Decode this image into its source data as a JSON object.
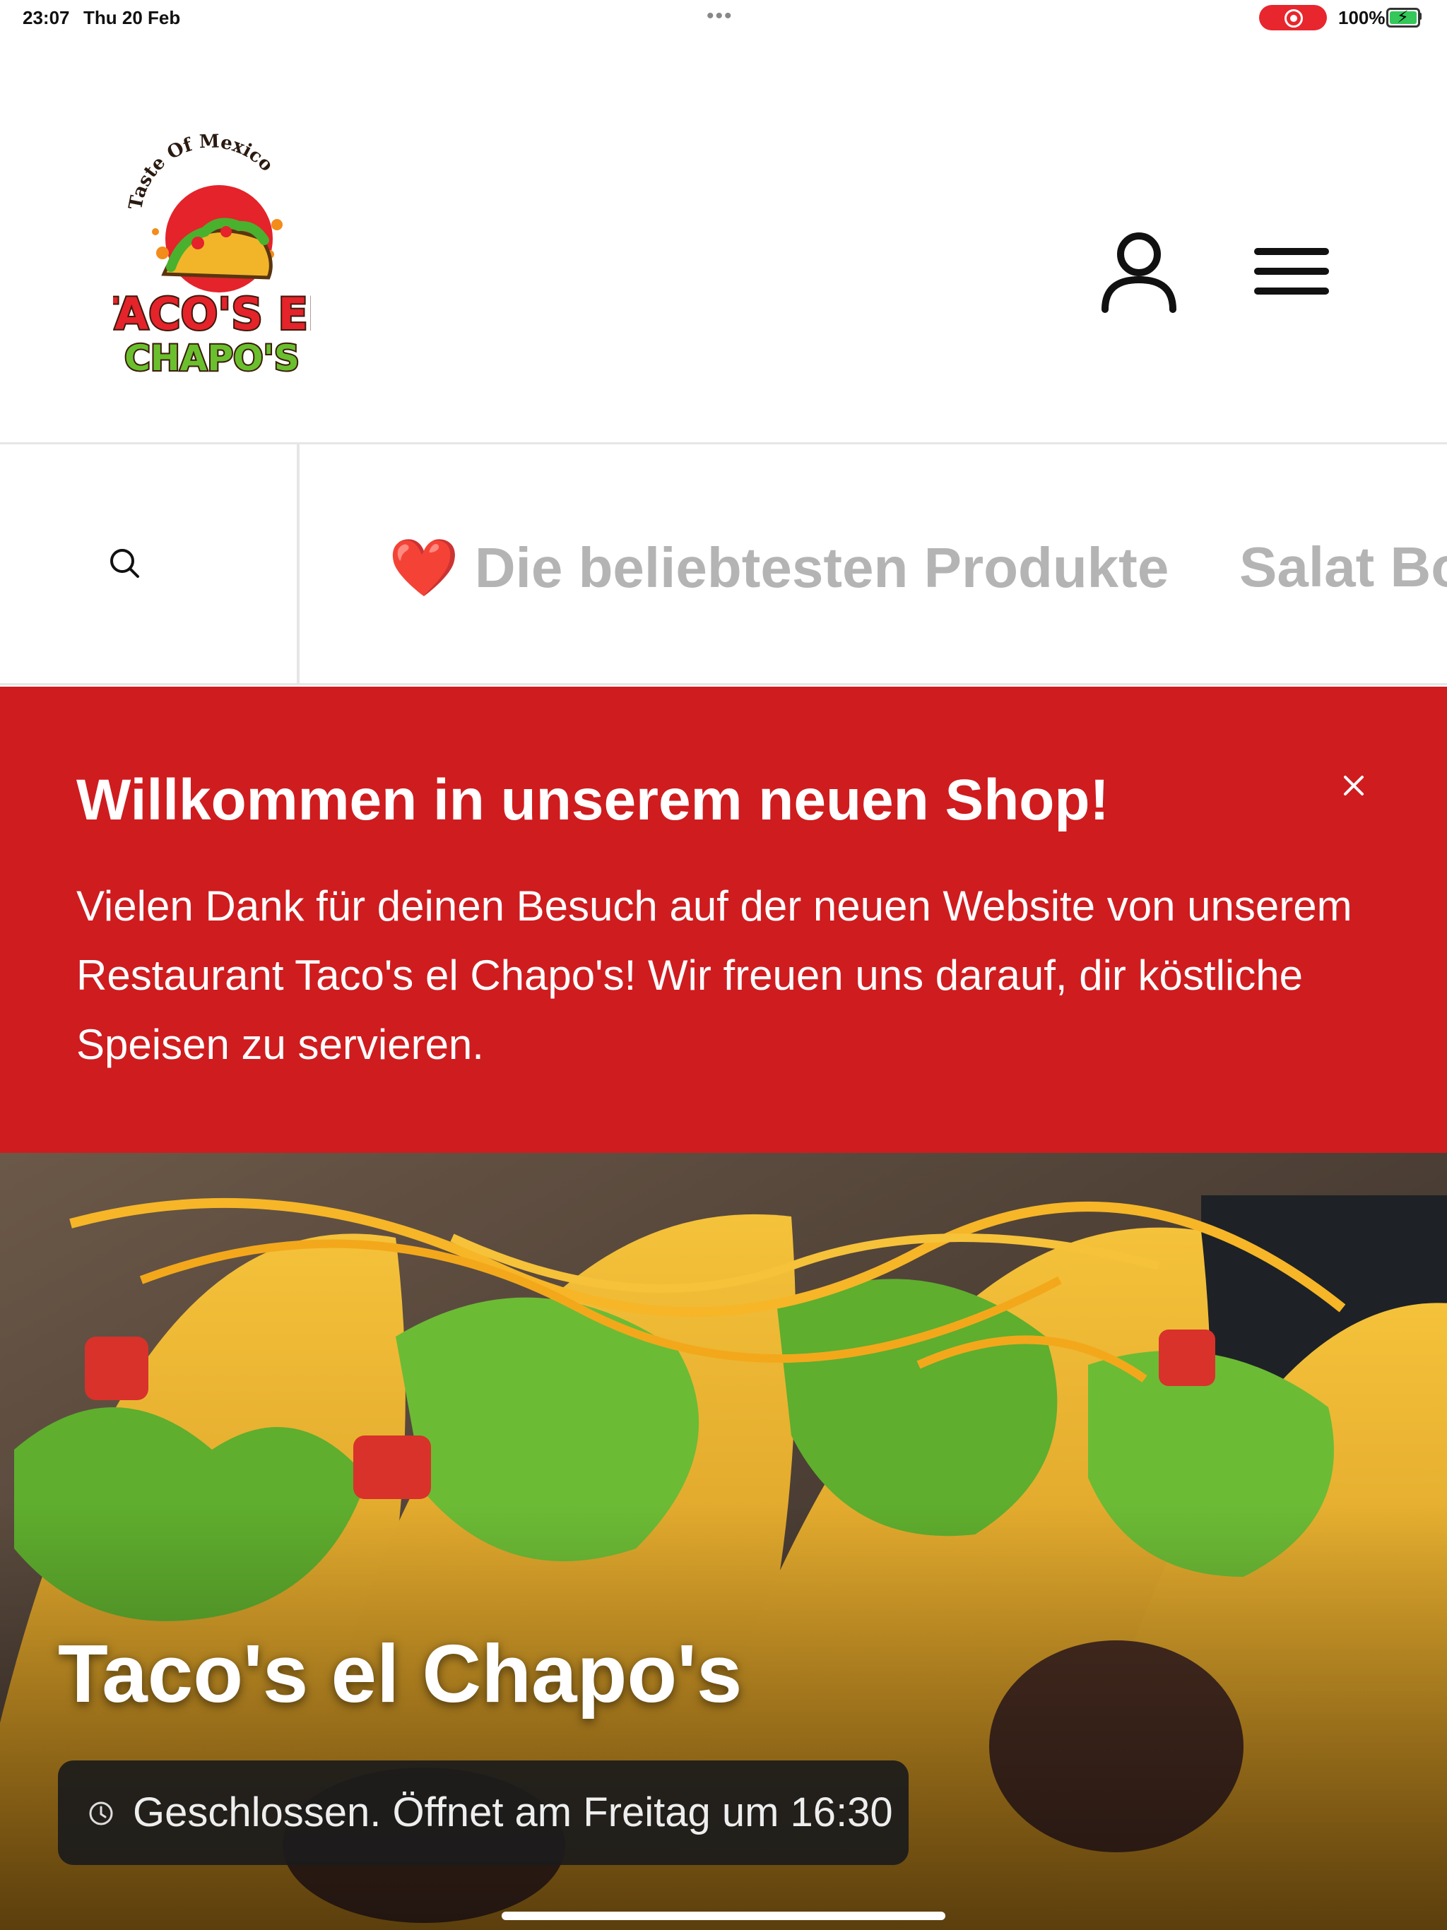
{
  "status_bar": {
    "time": "23:07",
    "date": "Thu 20 Feb",
    "battery": "100%",
    "record_indicator_color": "#e8262d",
    "battery_icon": "battery-charging-icon"
  },
  "header": {
    "logo": {
      "arc_text": "Taste Of Mexico",
      "line1": "TACO'S EL",
      "line2": "CHAPO'S"
    },
    "account_icon": "person-icon",
    "menu_icon": "hamburger-menu-icon"
  },
  "category_nav": {
    "search_icon": "search-icon",
    "items": [
      {
        "emoji": "❤️",
        "label": "Die beliebtesten Produkte"
      },
      {
        "label": "Salat Bowls"
      }
    ]
  },
  "banner": {
    "title": "Willkommen in unserem neuen Shop!",
    "text": "Vielen Dank für deinen Besuch auf der neuen Website von unserem Restaurant Taco's el Chapo's! Wir freuen uns darauf, dir köstliche Speisen zu servieren.",
    "close_icon": "close-icon",
    "background_color": "#cf1c1f"
  },
  "hero": {
    "title": "Taco's el Chapo's",
    "hours_icon": "clock-icon",
    "hours_text": "Geschlossen. Öffnet am Freitag um 16:30"
  }
}
